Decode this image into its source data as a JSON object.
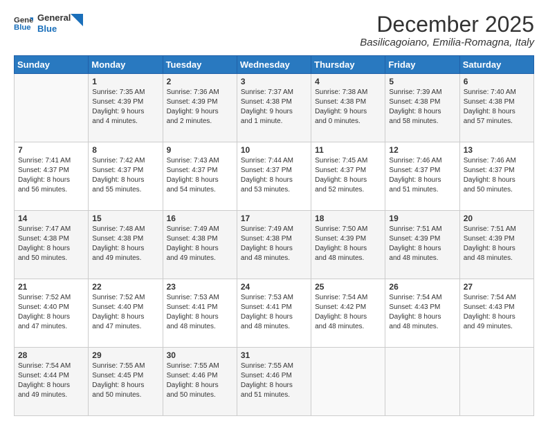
{
  "logo": {
    "line1": "General",
    "line2": "Blue"
  },
  "header": {
    "month": "December 2025",
    "subtitle": "Basilicagoiano, Emilia-Romagna, Italy"
  },
  "days": [
    "Sunday",
    "Monday",
    "Tuesday",
    "Wednesday",
    "Thursday",
    "Friday",
    "Saturday"
  ],
  "weeks": [
    [
      {
        "day": "",
        "content": ""
      },
      {
        "day": "1",
        "content": "Sunrise: 7:35 AM\nSunset: 4:39 PM\nDaylight: 9 hours\nand 4 minutes."
      },
      {
        "day": "2",
        "content": "Sunrise: 7:36 AM\nSunset: 4:39 PM\nDaylight: 9 hours\nand 2 minutes."
      },
      {
        "day": "3",
        "content": "Sunrise: 7:37 AM\nSunset: 4:38 PM\nDaylight: 9 hours\nand 1 minute."
      },
      {
        "day": "4",
        "content": "Sunrise: 7:38 AM\nSunset: 4:38 PM\nDaylight: 9 hours\nand 0 minutes."
      },
      {
        "day": "5",
        "content": "Sunrise: 7:39 AM\nSunset: 4:38 PM\nDaylight: 8 hours\nand 58 minutes."
      },
      {
        "day": "6",
        "content": "Sunrise: 7:40 AM\nSunset: 4:38 PM\nDaylight: 8 hours\nand 57 minutes."
      }
    ],
    [
      {
        "day": "7",
        "content": "Sunrise: 7:41 AM\nSunset: 4:37 PM\nDaylight: 8 hours\nand 56 minutes."
      },
      {
        "day": "8",
        "content": "Sunrise: 7:42 AM\nSunset: 4:37 PM\nDaylight: 8 hours\nand 55 minutes."
      },
      {
        "day": "9",
        "content": "Sunrise: 7:43 AM\nSunset: 4:37 PM\nDaylight: 8 hours\nand 54 minutes."
      },
      {
        "day": "10",
        "content": "Sunrise: 7:44 AM\nSunset: 4:37 PM\nDaylight: 8 hours\nand 53 minutes."
      },
      {
        "day": "11",
        "content": "Sunrise: 7:45 AM\nSunset: 4:37 PM\nDaylight: 8 hours\nand 52 minutes."
      },
      {
        "day": "12",
        "content": "Sunrise: 7:46 AM\nSunset: 4:37 PM\nDaylight: 8 hours\nand 51 minutes."
      },
      {
        "day": "13",
        "content": "Sunrise: 7:46 AM\nSunset: 4:37 PM\nDaylight: 8 hours\nand 50 minutes."
      }
    ],
    [
      {
        "day": "14",
        "content": "Sunrise: 7:47 AM\nSunset: 4:38 PM\nDaylight: 8 hours\nand 50 minutes."
      },
      {
        "day": "15",
        "content": "Sunrise: 7:48 AM\nSunset: 4:38 PM\nDaylight: 8 hours\nand 49 minutes."
      },
      {
        "day": "16",
        "content": "Sunrise: 7:49 AM\nSunset: 4:38 PM\nDaylight: 8 hours\nand 49 minutes."
      },
      {
        "day": "17",
        "content": "Sunrise: 7:49 AM\nSunset: 4:38 PM\nDaylight: 8 hours\nand 48 minutes."
      },
      {
        "day": "18",
        "content": "Sunrise: 7:50 AM\nSunset: 4:39 PM\nDaylight: 8 hours\nand 48 minutes."
      },
      {
        "day": "19",
        "content": "Sunrise: 7:51 AM\nSunset: 4:39 PM\nDaylight: 8 hours\nand 48 minutes."
      },
      {
        "day": "20",
        "content": "Sunrise: 7:51 AM\nSunset: 4:39 PM\nDaylight: 8 hours\nand 48 minutes."
      }
    ],
    [
      {
        "day": "21",
        "content": "Sunrise: 7:52 AM\nSunset: 4:40 PM\nDaylight: 8 hours\nand 47 minutes."
      },
      {
        "day": "22",
        "content": "Sunrise: 7:52 AM\nSunset: 4:40 PM\nDaylight: 8 hours\nand 47 minutes."
      },
      {
        "day": "23",
        "content": "Sunrise: 7:53 AM\nSunset: 4:41 PM\nDaylight: 8 hours\nand 48 minutes."
      },
      {
        "day": "24",
        "content": "Sunrise: 7:53 AM\nSunset: 4:41 PM\nDaylight: 8 hours\nand 48 minutes."
      },
      {
        "day": "25",
        "content": "Sunrise: 7:54 AM\nSunset: 4:42 PM\nDaylight: 8 hours\nand 48 minutes."
      },
      {
        "day": "26",
        "content": "Sunrise: 7:54 AM\nSunset: 4:43 PM\nDaylight: 8 hours\nand 48 minutes."
      },
      {
        "day": "27",
        "content": "Sunrise: 7:54 AM\nSunset: 4:43 PM\nDaylight: 8 hours\nand 49 minutes."
      }
    ],
    [
      {
        "day": "28",
        "content": "Sunrise: 7:54 AM\nSunset: 4:44 PM\nDaylight: 8 hours\nand 49 minutes."
      },
      {
        "day": "29",
        "content": "Sunrise: 7:55 AM\nSunset: 4:45 PM\nDaylight: 8 hours\nand 50 minutes."
      },
      {
        "day": "30",
        "content": "Sunrise: 7:55 AM\nSunset: 4:46 PM\nDaylight: 8 hours\nand 50 minutes."
      },
      {
        "day": "31",
        "content": "Sunrise: 7:55 AM\nSunset: 4:46 PM\nDaylight: 8 hours\nand 51 minutes."
      },
      {
        "day": "",
        "content": ""
      },
      {
        "day": "",
        "content": ""
      },
      {
        "day": "",
        "content": ""
      }
    ]
  ]
}
